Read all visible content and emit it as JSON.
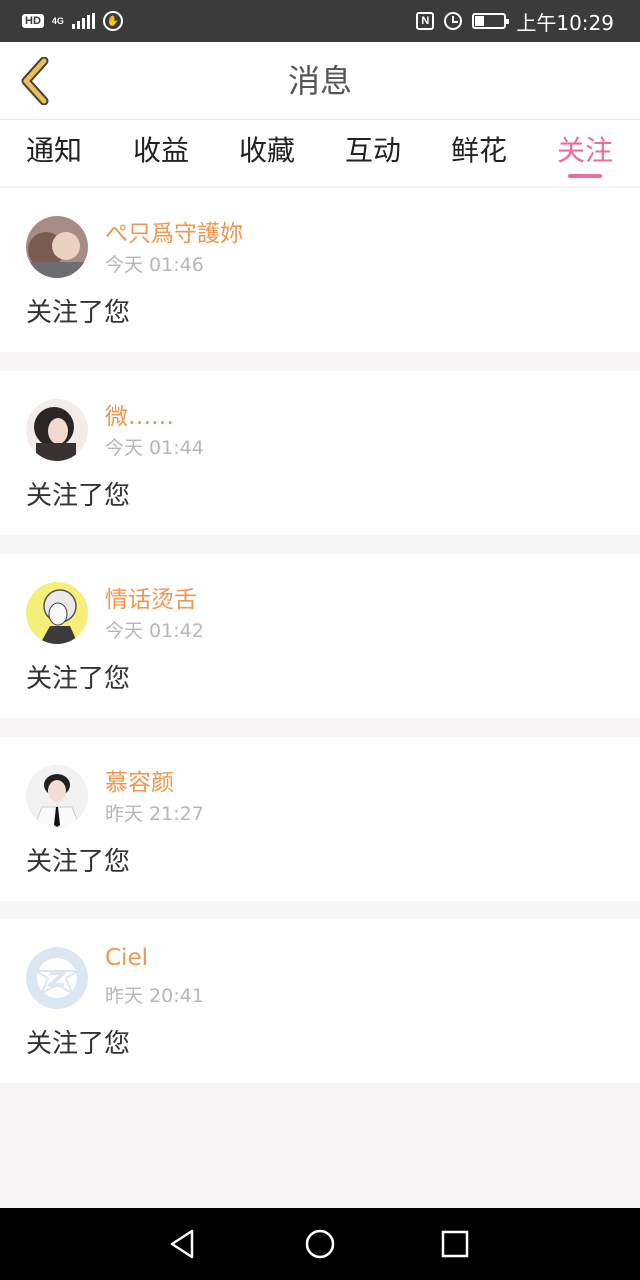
{
  "status_bar": {
    "hd_label": "HD",
    "network_label": "4G",
    "time": "上午10:29",
    "nfc_label": "N",
    "battery_level": 0.3,
    "icons": [
      "hd-icon",
      "signal-icon",
      "shield-icon",
      "nfc-icon",
      "alarm-icon",
      "battery-icon"
    ]
  },
  "header": {
    "title": "消息",
    "back_icon": "chevron-left-icon",
    "back_color": "#e8c15a"
  },
  "tabs": [
    {
      "label": "通知",
      "active": false
    },
    {
      "label": "收益",
      "active": false
    },
    {
      "label": "收藏",
      "active": false
    },
    {
      "label": "互动",
      "active": false
    },
    {
      "label": "鲜花",
      "active": false
    },
    {
      "label": "关注",
      "active": true
    }
  ],
  "colors": {
    "accent": "#ec6d9c",
    "username": "#f0964e",
    "timestamp": "#b7b7b7"
  },
  "notifications": [
    {
      "name": "ぺ只爲守護妳",
      "time": "今天 01:46",
      "message": "关注了您"
    },
    {
      "name": "微……",
      "time": "今天 01:44",
      "message": "关注了您"
    },
    {
      "name": "情话烫舌",
      "time": "今天 01:42",
      "message": "关注了您"
    },
    {
      "name": "慕容颜",
      "time": "昨天 21:27",
      "message": "关注了您"
    },
    {
      "name": "Ciel",
      "time": "昨天 20:41",
      "message": "关注了您"
    }
  ],
  "nav_bar": {
    "buttons": [
      "back-triangle-icon",
      "home-circle-icon",
      "recents-square-icon"
    ]
  }
}
